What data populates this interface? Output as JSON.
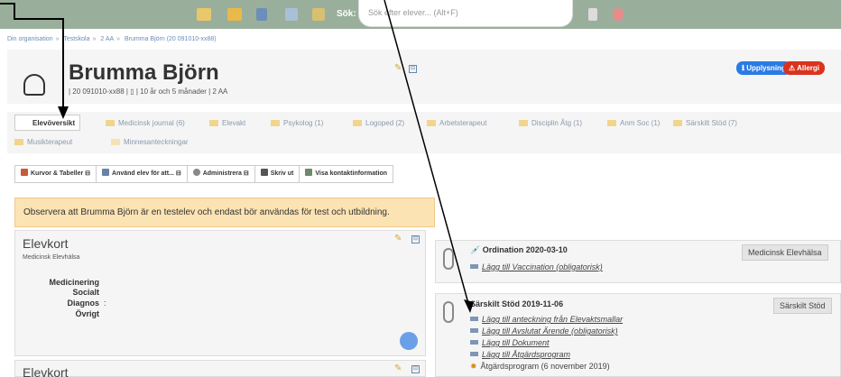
{
  "topbar": {
    "search_label": "Sök:",
    "search_placeholder": "Sök efter elever... (Alt+F)"
  },
  "breadcrumb": {
    "items": [
      "Din organisation",
      "Testskola",
      "2 AA",
      "Brumma Björn (20 091010-xx88)"
    ]
  },
  "header": {
    "name": "Brumma Björn",
    "meta": "| 20 091010-xx88 | ▯ | 10 år och 5 månader | 2 AA",
    "badge_info": "ℹ Upplysning",
    "badge_allergy": "⚠ Allergi"
  },
  "tabs": [
    {
      "label": "Elevöversikt"
    },
    {
      "label": "Medicinsk journal (6)"
    },
    {
      "label": "Elevakt"
    },
    {
      "label": "Psykolog (1)"
    },
    {
      "label": "Logoped (2)"
    },
    {
      "label": "Arbetsterapeut"
    },
    {
      "label": "Disciplin Åtg (1)"
    },
    {
      "label": "Anm Soc (1)"
    },
    {
      "label": "Särskilt Stöd (7)"
    },
    {
      "label": "Musikterapeut"
    },
    {
      "label": "Minnesanteckningar"
    }
  ],
  "toolbar": {
    "buttons": [
      {
        "label": "Kurvor & Tabeller ⊟"
      },
      {
        "label": "Använd elev för att... ⊟"
      },
      {
        "label": "Administrera ⊟"
      },
      {
        "label": "Skriv ut"
      },
      {
        "label": "Visa kontaktinformation"
      }
    ]
  },
  "warning": "Observera att Brumma Björn är en testelev och endast bör användas för test och utbildning.",
  "elevkort": {
    "title": "Elevkort",
    "subtitle": "Medicinsk Elevhälsa",
    "fields": [
      "Medicinering",
      "Socialt",
      "Diagnos",
      "Övrigt"
    ],
    "diagnos_sep": ":",
    "title2": "Elevkort"
  },
  "ordination": {
    "title": "Ordination",
    "date": "2020-03-10",
    "tag": "Medicinsk Elevhälsa",
    "links": [
      "Lägg till Vaccination (obligatorisk)"
    ]
  },
  "sarskilt": {
    "title": "Särskilt Stöd",
    "date": "2019-11-06",
    "tag": "Särskilt Stöd",
    "links": [
      "Lägg till anteckning från Elevaktsmallar",
      "Lägg till Avslutat Ärende (obligatorisk)",
      "Lägg till Dokument",
      "Lägg till Åtgärdsprogram",
      "Åtgärdsprogram (6 november 2019)"
    ]
  }
}
